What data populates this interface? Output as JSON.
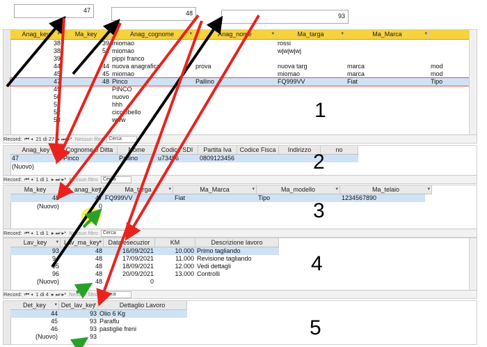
{
  "top_boxes": [
    "47",
    "48",
    "93"
  ],
  "grid1": {
    "headers": [
      "Anag_key",
      "Ma_key",
      "Anag_cognome",
      "Anag_nome",
      "Ma_targa",
      "Ma_Marca"
    ],
    "rows": [
      [
        "38",
        "39",
        "miomao",
        "",
        "rossi",
        "",
        ""
      ],
      [
        "38",
        "51",
        "miomao",
        "",
        "wjwjwjwj",
        "",
        ""
      ],
      [
        "39",
        "",
        "pippi franco",
        "",
        "",
        "",
        ""
      ],
      [
        "44",
        "44",
        "nuova anagrafica",
        "prova",
        "nuova targ",
        "marca",
        "mod"
      ],
      [
        "45",
        "45",
        "miomao",
        "",
        "miomao",
        "marca",
        "mod"
      ],
      [
        "47",
        "48",
        "Pinco",
        "Pallino",
        "FQ999VV",
        "Fiat",
        "Tipo"
      ],
      [
        "49",
        "",
        "PINCO",
        "",
        "",
        "",
        ""
      ],
      [
        "50",
        "",
        "nuovo",
        "",
        "",
        "",
        ""
      ],
      [
        "51",
        "",
        "hhh",
        "",
        "",
        "",
        ""
      ],
      [
        "52",
        "",
        "cicciobello",
        "",
        "",
        "",
        ""
      ],
      [
        "53",
        "",
        "www",
        "",
        "",
        "",
        ""
      ]
    ],
    "nav": {
      "record": "Record:",
      "pos": "21 di 27",
      "filter": "Nessun filtro",
      "search": "Cerca"
    }
  },
  "grid2": {
    "headers": [
      "Anag_key",
      "Cognome o Ditta",
      "Nome",
      "Codice SDI",
      "Partita Iva",
      "Codice Fisca",
      "Indirizzo",
      "no"
    ],
    "rows": [
      [
        "47",
        "Pinco",
        "Pallino",
        "u73456",
        "0809123456",
        "",
        "",
        ""
      ]
    ],
    "new_row": "(Nuovo)",
    "nav": {
      "record": "Record:",
      "pos": "1 di 1",
      "filter": "Nessun filtro",
      "search": "Cerca"
    }
  },
  "grid3": {
    "headers": [
      "Ma_key",
      "Ma_anag_key",
      "Ma_targa",
      "Ma_Marca",
      "Ma_modello",
      "Ma_telaio"
    ],
    "rows": [
      [
        "48",
        "47",
        "FQ999VV",
        "Fiat",
        "Tipo",
        "1234567890"
      ]
    ],
    "new_row": [
      "(Nuovo)",
      "0"
    ],
    "nav": {
      "record": "Record:",
      "pos": "1 di 1",
      "filter": "Nessun filtro",
      "search": "Cerca"
    }
  },
  "grid4": {
    "headers": [
      "Lav_key",
      "Lav_ma_key",
      "Data esecuzior",
      "KM",
      "Descrizione lavoro"
    ],
    "rows": [
      [
        "93",
        "48",
        "16/09/2021",
        "10.000",
        "Primo tagliando"
      ],
      [
        "94",
        "48",
        "17/09/2021",
        "11.000",
        "Revisione tagliando"
      ],
      [
        "95",
        "48",
        "18/09/2021",
        "12.000",
        "Vedi dettagli"
      ],
      [
        "96",
        "48",
        "20/09/2021",
        "13.000",
        "Controlli"
      ]
    ],
    "new_row": [
      "(Nuovo)",
      "48",
      "0"
    ],
    "nav": {
      "record": "Record:",
      "pos": "1 di 4",
      "filter": "Nessun filtro",
      "search": "Cerca"
    }
  },
  "grid5": {
    "headers": [
      "Det_key",
      "Det_lav_key",
      "Dettaglio Lavoro"
    ],
    "rows": [
      [
        "44",
        "93",
        "Olio 6 Kg"
      ],
      [
        "45",
        "93",
        "Paraflu"
      ],
      [
        "46",
        "93",
        "pastiglie freni"
      ]
    ],
    "new_row": [
      "(Nuovo)",
      "93"
    ]
  },
  "labels": [
    "1",
    "2",
    "3",
    "4",
    "5"
  ],
  "colors": {
    "header_yellow": "#f6d23c",
    "selection": "#cfe2f5",
    "arrow_red": "#e8231e",
    "arrow_black": "#000000",
    "arrow_green": "#2aa02a"
  }
}
